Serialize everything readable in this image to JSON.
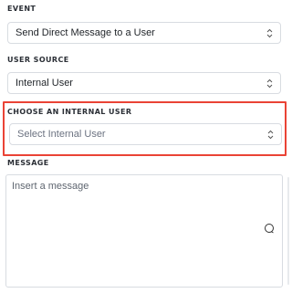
{
  "event": {
    "label": "EVENT",
    "value": "Send Direct Message to a User"
  },
  "user_source": {
    "label": "USER SOURCE",
    "value": "Internal User"
  },
  "internal_user": {
    "label": "CHOOSE AN INTERNAL USER",
    "placeholder": "Select Internal User"
  },
  "message": {
    "label": "MESSAGE",
    "placeholder": "Insert a message"
  },
  "colors": {
    "highlight": "#ea4335",
    "border": "#d8dce1"
  }
}
